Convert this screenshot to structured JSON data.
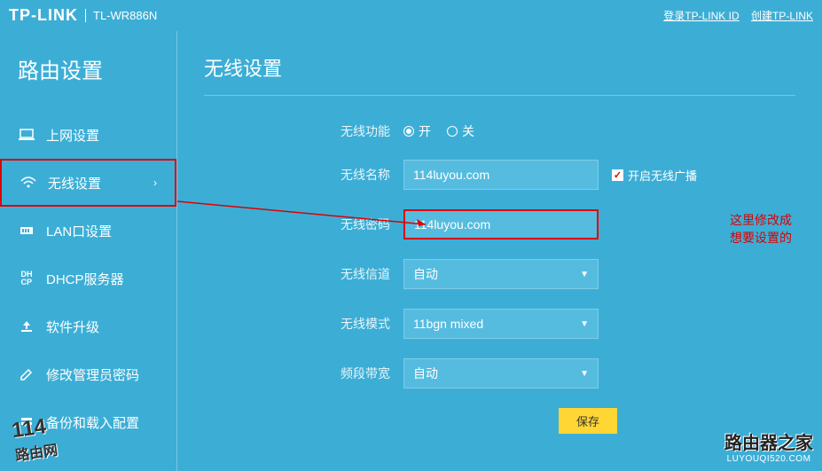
{
  "header": {
    "logo": "TP-LINK",
    "model": "TL-WR886N",
    "login_link": "登录TP-LINK ID",
    "create_link": "创建TP-LINK"
  },
  "sidebar": {
    "title": "路由设置",
    "items": [
      {
        "label": "上网设置"
      },
      {
        "label": "无线设置"
      },
      {
        "label": "LAN口设置"
      },
      {
        "label": "DHCP服务器"
      },
      {
        "label": "软件升级"
      },
      {
        "label": "修改管理员密码"
      },
      {
        "label": "备份和载入配置"
      }
    ]
  },
  "page": {
    "title": "无线设置",
    "wireless_func_label": "无线功能",
    "radio_on": "开",
    "radio_off": "关",
    "ssid_label": "无线名称",
    "ssid_value": "114luyou.com",
    "broadcast_label": "开启无线广播",
    "password_label": "无线密码",
    "password_value": "114luyou.com",
    "channel_label": "无线信道",
    "channel_value": "自动",
    "mode_label": "无线模式",
    "mode_value": "11bgn mixed",
    "bandwidth_label": "频段带宽",
    "bandwidth_value": "自动",
    "save_btn": "保存"
  },
  "annotation": {
    "line1": "这里修改成",
    "line2": "想要设置的"
  },
  "watermarks": {
    "w1_top": "114",
    "w1_bottom": "路由网",
    "w2_big": "路由器之家",
    "w2_url": "LUYOUQI520.COM"
  }
}
